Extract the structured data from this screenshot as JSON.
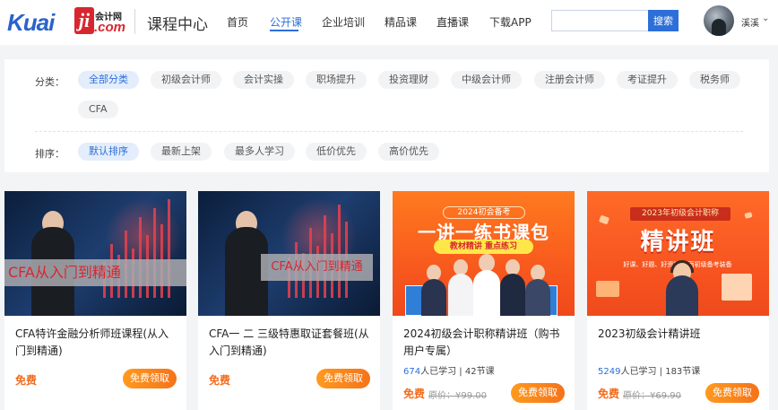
{
  "header": {
    "logo": {
      "brand": "Kuai",
      "mark": "ji",
      "cn": "会计网",
      "com": ".com"
    },
    "site_title": "课程中心",
    "nav": [
      {
        "label": "首页",
        "active": false
      },
      {
        "label": "公开课",
        "active": true
      },
      {
        "label": "企业培训",
        "active": false
      },
      {
        "label": "精品课",
        "active": false
      },
      {
        "label": "直播课",
        "active": false
      },
      {
        "label": "下载APP",
        "active": false
      }
    ],
    "search": {
      "placeholder": "",
      "button": "搜索"
    },
    "user": {
      "name": "溪溪",
      "caret": "⌄"
    }
  },
  "filters": {
    "category_label": "分类：",
    "categories": [
      "全部分类",
      "初级会计师",
      "会计实操",
      "职场提升",
      "投资理财",
      "中级会计师",
      "注册会计师",
      "考证提升",
      "税务师",
      "CFA"
    ],
    "category_active": 0,
    "sort_label": "排序：",
    "sorts": [
      "默认排序",
      "最新上架",
      "最多人学习",
      "低价优先",
      "高价优先"
    ],
    "sort_active": 0
  },
  "cards": [
    {
      "thumb": {
        "banner": "CFA从入门到精通"
      },
      "title": "CFA特许金融分析师班课程(从入门到精通)",
      "price": "免费",
      "button": "免费领取"
    },
    {
      "thumb": {
        "banner": "CFA从入门到精通"
      },
      "title": "CFA一 二 三级特惠取证套餐班(从入门到精通)",
      "price": "免费",
      "button": "免费领取"
    },
    {
      "thumb": {
        "ribbon": "2024初会备考",
        "headline": "一讲一练书课包",
        "tag": "教材精讲 重点练习"
      },
      "title": "2024初级会计职称精讲班（购书用户专属）",
      "learners": "674",
      "learners_suffix": "人已学习",
      "sep": "|",
      "lessons": "42节课",
      "price": "免费",
      "original_price": "原价：¥99.00",
      "button": "免费领取"
    },
    {
      "thumb": {
        "ribbon": "2023年初级会计职称",
        "headline": "精讲班",
        "tag": "好课、好题、好资料,全面初级备考装备"
      },
      "title": "2023初级会计精讲班",
      "learners": "5249",
      "learners_suffix": "人已学习",
      "sep": "|",
      "lessons": "183节课",
      "price": "免费",
      "original_price": "原价：¥69.90",
      "button": "免费领取"
    }
  ],
  "colors": {
    "accent": "#2d6fd9",
    "price": "#f36b1c",
    "button": "#f5731a"
  }
}
